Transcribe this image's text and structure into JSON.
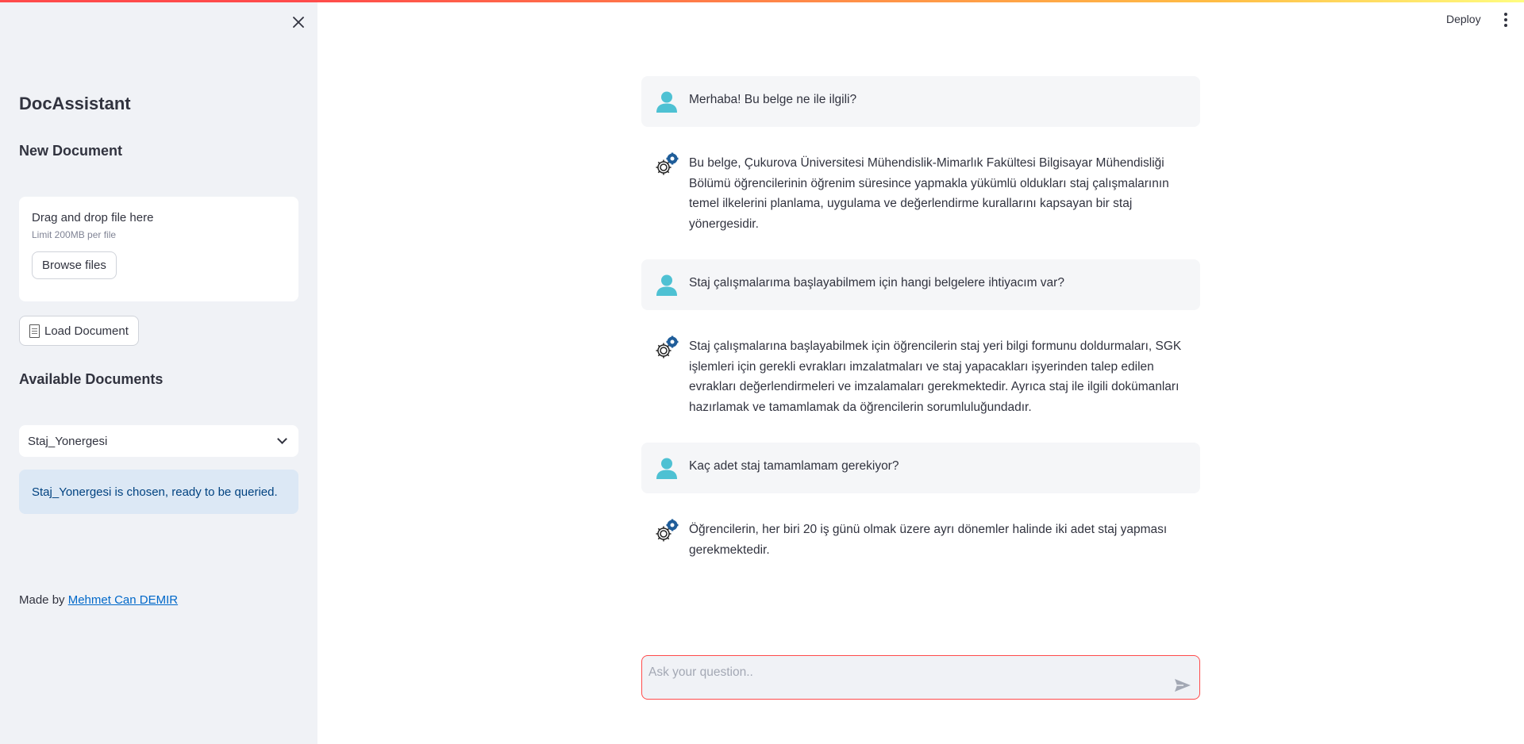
{
  "sidebar": {
    "app_title": "DocAssistant",
    "new_document_title": "New Document",
    "uploader": {
      "drag_text": "Drag and drop file here",
      "limit_text": "Limit 200MB per file",
      "browse_label": "Browse files"
    },
    "load_button_label": "Load Document",
    "available_documents_title": "Available Documents",
    "selected_document": "Staj_Yonergesi",
    "info_message": "Staj_Yonergesi is chosen, ready to be queried.",
    "made_by_prefix": "Made by",
    "author_link": "Mehmet Can DEMIR"
  },
  "header": {
    "deploy_label": "Deploy"
  },
  "chat": {
    "messages": [
      {
        "role": "user",
        "text": "Merhaba! Bu belge ne ile ilgili?"
      },
      {
        "role": "assistant",
        "text": "Bu belge, Çukurova Üniversitesi Mühendislik-Mimarlık Fakültesi Bilgisayar Mühendisliği Bölümü öğrencilerinin öğrenim süresince yapmakla yükümlü oldukları staj çalışmalarının temel ilkelerini planlama, uygulama ve değerlendirme kurallarını kapsayan bir staj yönergesidir."
      },
      {
        "role": "user",
        "text": "Staj çalışmalarıma başlayabilmem için hangi belgelere ihtiyacım var?"
      },
      {
        "role": "assistant",
        "text": "Staj çalışmalarına başlayabilmek için öğrencilerin staj yeri bilgi formunu doldurmaları, SGK işlemleri için gerekli evrakları imzalatmaları ve staj yapacakları işyerinden talep edilen evrakları değerlendirmeleri ve imzalamaları gerekmektedir. Ayrıca staj ile ilgili dokümanları hazırlamak ve tamamlamak da öğrencilerin sorumluluğundadır."
      },
      {
        "role": "user",
        "text": "Kaç adet staj tamamlamam gerekiyor?"
      },
      {
        "role": "assistant",
        "text": "Öğrencilerin, her biri 20 iş günü olmak üzere ayrı dönemler halinde iki adet staj yapması gerekmektedir."
      }
    ],
    "input_placeholder": "Ask your question.."
  },
  "icons": {
    "user_avatar": "user-icon",
    "assistant_avatar": "gears-icon",
    "send": "send-icon",
    "close": "close-icon",
    "menu": "kebab-menu-icon"
  },
  "colors": {
    "user_avatar": "#4ec1d3",
    "assistant_gear_accent": "#1f5d99",
    "primary": "#ff4b4b",
    "link": "#0068c9",
    "info_bg": "#dce8f5",
    "info_text": "#004280"
  }
}
